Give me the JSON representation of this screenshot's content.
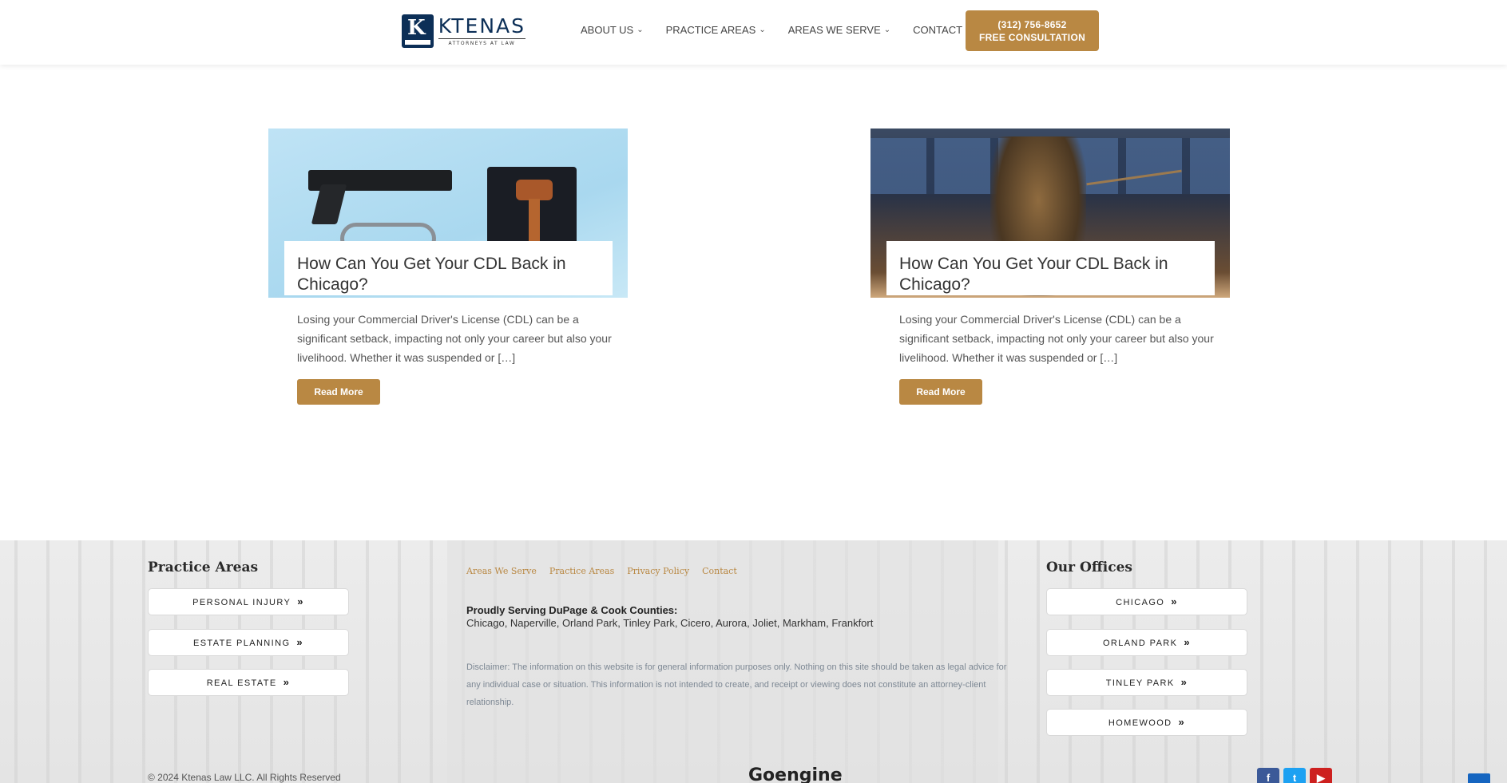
{
  "header": {
    "logo": {
      "name": "KTENAS",
      "sub": "ATTORNEYS AT LAW",
      "mark": "K"
    },
    "nav": [
      {
        "label": "ABOUT US",
        "has_dropdown": true
      },
      {
        "label": "PRACTICE AREAS",
        "has_dropdown": true
      },
      {
        "label": "AREAS WE SERVE",
        "has_dropdown": true
      },
      {
        "label": "CONTACT",
        "has_dropdown": false
      }
    ],
    "cta": {
      "phone": "(312) 756-8652",
      "label": "FREE CONSULTATION"
    }
  },
  "posts": [
    {
      "title": "How Can You Get Your CDL Back in Chicago?",
      "excerpt": "Losing your Commercial Driver's License (CDL) can be a significant setback, impacting not only your career but also your livelihood. Whether it was suspended or […]",
      "read_more": "Read More"
    },
    {
      "title": "How Can You Get Your CDL Back in Chicago?",
      "excerpt": "Losing your Commercial Driver's License (CDL) can be a significant setback, impacting not only your career but also your livelihood. Whether it was suspended or […]",
      "read_more": "Read More"
    }
  ],
  "footer": {
    "practice_heading": "Practice Areas",
    "practice_items": [
      "PERSONAL INJURY",
      "ESTATE PLANNING",
      "REAL ESTATE"
    ],
    "links": [
      "Areas We Serve",
      "Practice Areas",
      "Privacy Policy",
      "Contact"
    ],
    "serving_title": "Proudly Serving DuPage & Cook Counties:",
    "serving_list": "Chicago, Naperville, Orland Park, Tinley Park, Cicero, Aurora, Joliet, Markham, Frankfort",
    "disclaimer": "Disclaimer: The information on this website is for general information purposes only. Nothing on this site should be taken as legal advice for any individual case or situation. This information is not intended to create, and receipt or viewing does not constitute an attorney-client relationship.",
    "offices_heading": "Our Offices",
    "offices": [
      "CHICAGO",
      "ORLAND PARK",
      "TINLEY PARK",
      "HOMEWOOD"
    ],
    "copyright": "© 2024 Ktenas Law LLC. All Rights Reserved",
    "agency": "Goengine",
    "socials": [
      {
        "name": "facebook-icon",
        "glyph": "f"
      },
      {
        "name": "twitter-icon",
        "glyph": "t"
      },
      {
        "name": "youtube-icon",
        "glyph": "▶"
      }
    ]
  },
  "icons": {
    "chevron": "chevron-down-icon",
    "arrow": "double-chevron-right-icon"
  },
  "colors": {
    "accent": "#b98843",
    "navy": "#0c2f57"
  }
}
